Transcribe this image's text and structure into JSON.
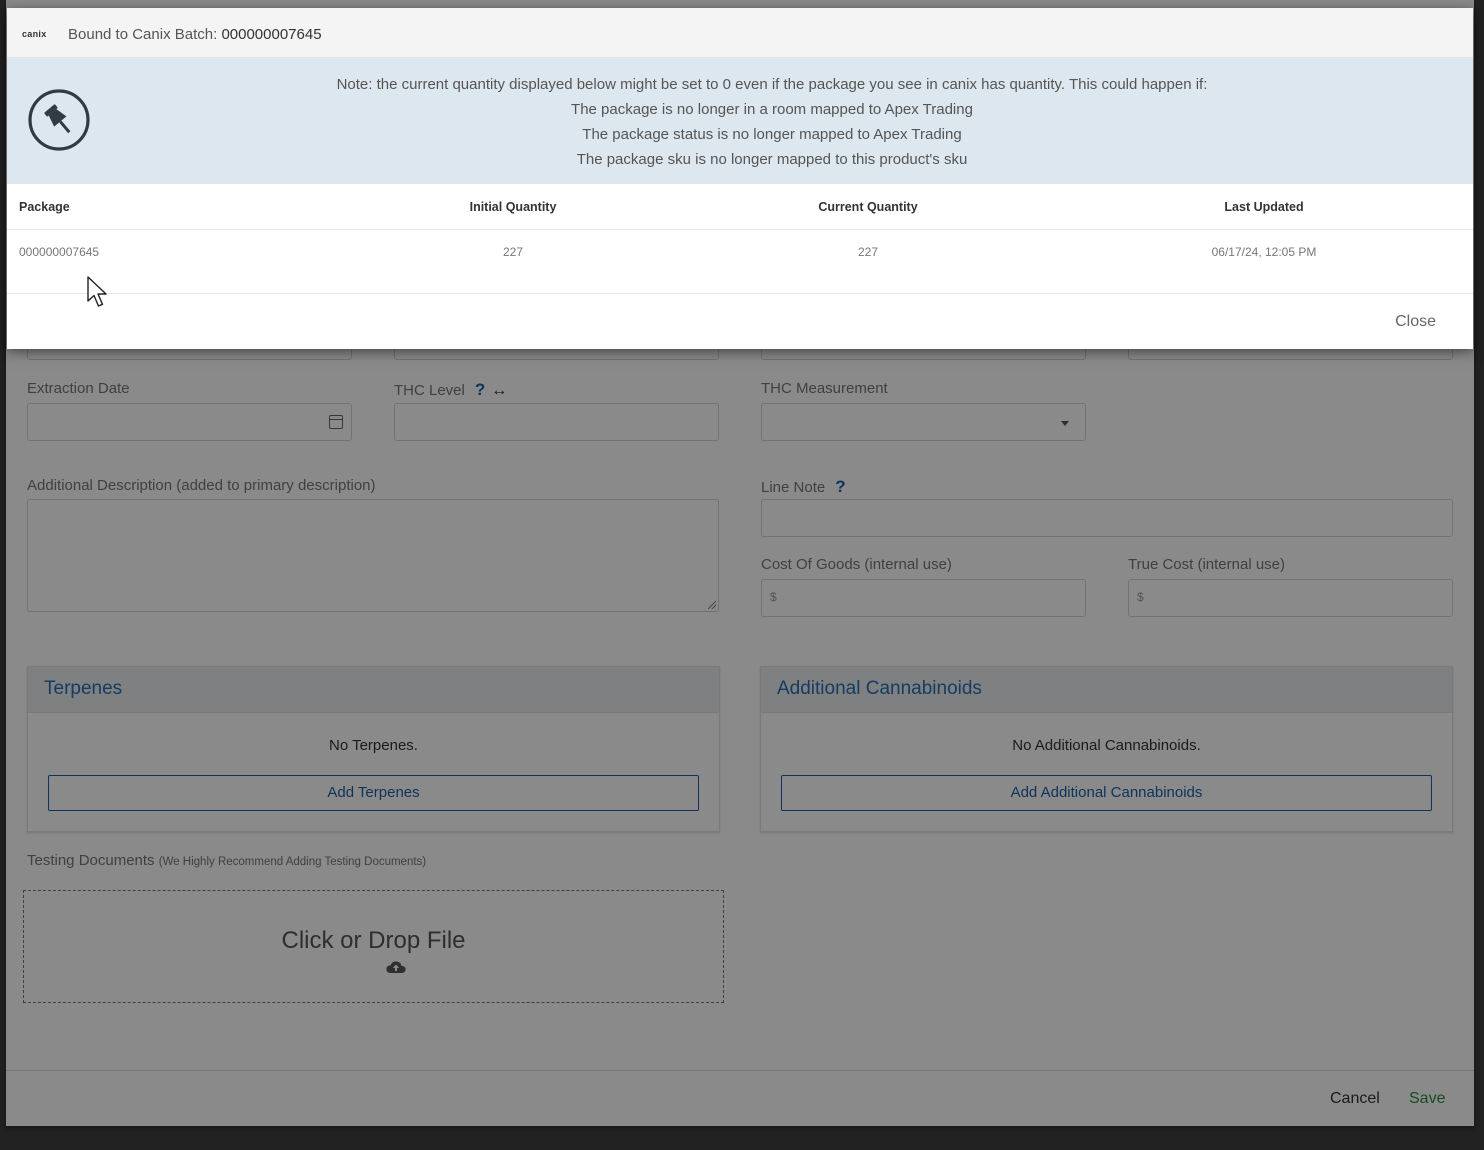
{
  "modal": {
    "brand": "canix",
    "title_prefix": "Bound to Canix Batch:",
    "batch_number": "000000007645",
    "notice_lines": [
      "Note: the current quantity displayed below might be set to 0 even if the package you see in canix has quantity. This could happen if:",
      "The package is no longer in a room mapped to Apex Trading",
      "The package status is no longer mapped to Apex Trading",
      "The package sku is no longer mapped to this product's sku"
    ],
    "table": {
      "headers": [
        "Package",
        "Initial Quantity",
        "Current Quantity",
        "Last Updated"
      ],
      "rows": [
        [
          "000000007645",
          "227",
          "227",
          "06/17/24, 12:05 PM"
        ]
      ]
    },
    "close_label": "Close",
    "icon": "pin-icon"
  },
  "form": {
    "extraction_date_label": "Extraction Date",
    "thc_level_label": "THC Level",
    "thc_measurement_label": "THC Measurement",
    "additional_description_label": "Additional Description (added to primary description)",
    "line_note_label": "Line Note",
    "cost_of_goods_label": "Cost Of Goods (internal use)",
    "true_cost_label": "True Cost (internal use)",
    "currency_prefix": "$",
    "help_glyph": "?",
    "terpenes": {
      "title": "Terpenes",
      "empty": "No Terpenes.",
      "button": "Add Terpenes"
    },
    "cannabinoids": {
      "title": "Additional Cannabinoids",
      "empty": "No Additional Cannabinoids.",
      "button": "Add Additional Cannabinoids"
    },
    "testing_documents_label": "Testing Documents",
    "testing_documents_hint": "(We Highly Recommend Adding Testing Documents)",
    "dropzone_text": "Click or Drop File"
  },
  "footer": {
    "cancel_label": "Cancel",
    "save_label": "Save"
  },
  "colors": {
    "accent": "#1e5fa8",
    "notice_bg": "#dde7ef",
    "save": "#2e8b3a"
  }
}
